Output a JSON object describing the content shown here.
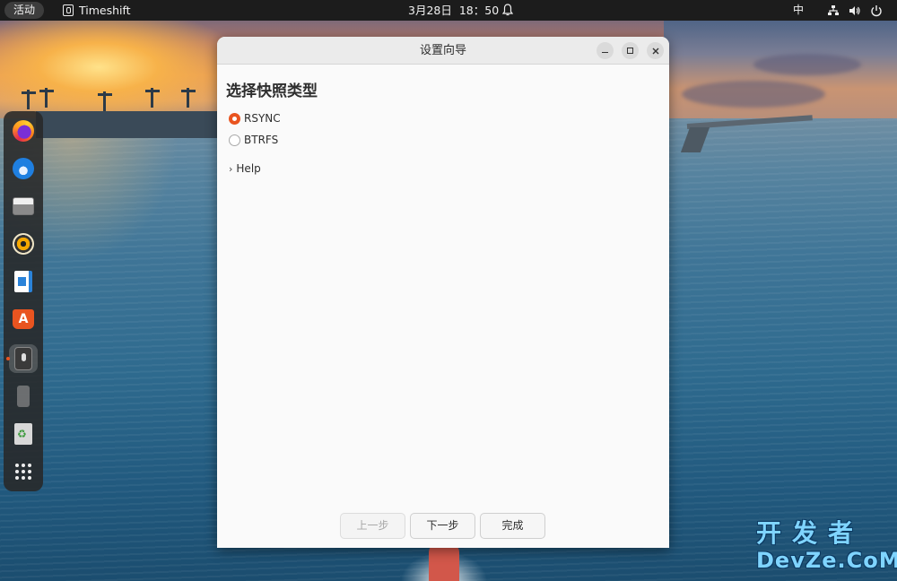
{
  "topbar": {
    "activities": "活动",
    "app_name": "Timeshift",
    "date": "3月28日",
    "time": "18：50",
    "input_method": "中",
    "icons": [
      "network-icon",
      "volume-icon",
      "power-icon"
    ]
  },
  "dock": {
    "apps": [
      "firefox",
      "thunderbird",
      "files",
      "rhythmbox",
      "libreoffice-writer",
      "app-center",
      "timeshift",
      "usb-drive",
      "trash",
      "show-apps"
    ]
  },
  "window": {
    "title": "设置向导",
    "heading": "选择快照类型",
    "options": [
      {
        "label": "RSYNC",
        "selected": true
      },
      {
        "label": "BTRFS",
        "selected": false
      }
    ],
    "help_label": "Help",
    "buttons": {
      "previous": "上一步",
      "next": "下一步",
      "finish": "完成"
    }
  },
  "watermark": {
    "line1": "开发者",
    "line2": "DevZe.CoM"
  },
  "colors": {
    "accent": "#e95420",
    "topbar_bg": "#1c1c1c",
    "window_bg": "#fafafa",
    "titlebar_bg": "#ebebeb"
  }
}
